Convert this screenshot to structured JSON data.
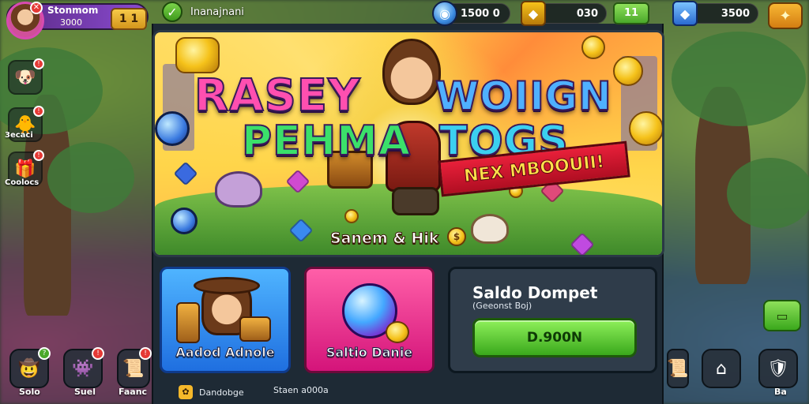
{
  "header": {
    "profile_name": "Stonmom",
    "profile_score": "3000",
    "profile_badge": "✕",
    "level": "1 1",
    "quest_label": "Inanajnani",
    "resources": [
      {
        "icon": "globe-icon",
        "value": "1500 0"
      },
      {
        "icon": "treasure-icon",
        "value": "030"
      },
      {
        "icon": "treasure-icon",
        "value": "3500"
      }
    ],
    "plus_label": "11"
  },
  "side_menu": [
    {
      "icon": "dog-icon",
      "label": ""
    },
    {
      "icon": "chick-icon",
      "label": "3ecaci"
    },
    {
      "icon": "gift-icon",
      "label": "Coolocs"
    }
  ],
  "banner": {
    "title_line1_a": "RASEY",
    "title_line1_b": "WOIIGN",
    "title_line2_a": "PEHMA",
    "title_line2_b": "TOGS",
    "ribbon": "NEX MBOOUII!",
    "caption": "Sanem & Hik"
  },
  "cards": [
    {
      "name": "card-adventure",
      "label": "Aadod Adnole"
    },
    {
      "name": "card-orb",
      "label": "Saltio Danie"
    }
  ],
  "wallet": {
    "title": "Saldo Dompet",
    "subtitle": "(Geeonst Boj)",
    "button_label": "D.900N"
  },
  "bottom_bar": {
    "item1": "Dandobge",
    "item2": "Staen a000a"
  },
  "dock_left": [
    {
      "icon": "cowboy-icon",
      "label": "Solo"
    },
    {
      "icon": "monster-icon",
      "label": "Suel"
    },
    {
      "icon": "scroll-icon",
      "label": "Faanc"
    }
  ],
  "dock_right": [
    {
      "icon": "scroll-icon",
      "label": ""
    },
    {
      "icon": "house-icon",
      "label": ""
    },
    {
      "icon": "shield-icon",
      "label": "Ba"
    }
  ],
  "colors": {
    "accent_green": "#4aa82a",
    "accent_purple": "#8a4bd0",
    "card_blue": "#1f6fe0",
    "card_pink": "#d4147a",
    "wallet_bg": "#2f3c4a"
  }
}
